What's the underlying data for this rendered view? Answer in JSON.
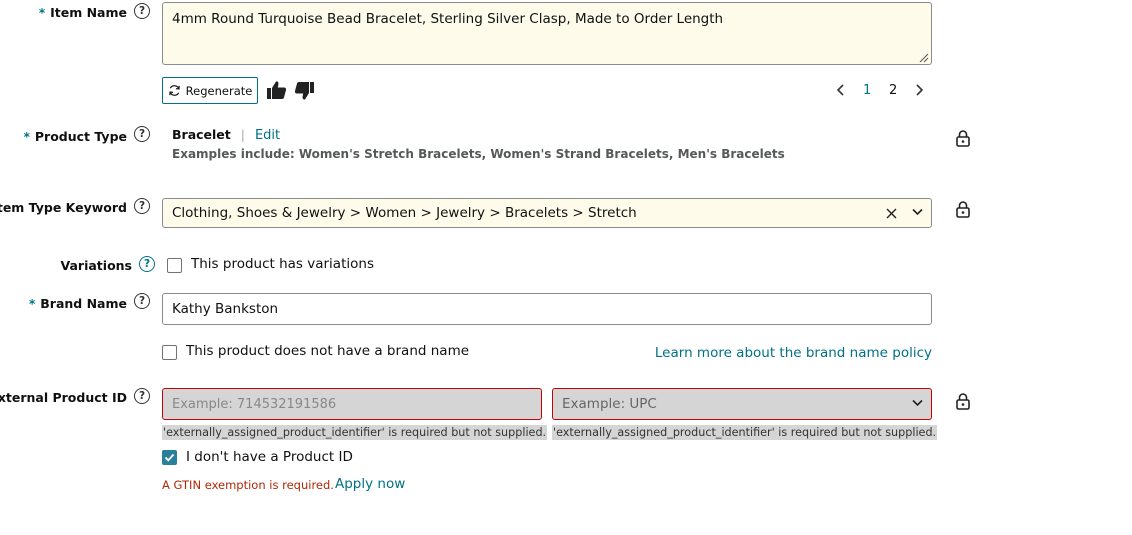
{
  "item_name": {
    "label": "Item Name",
    "required_mark": "*",
    "value": "4mm Round Turquoise Bead Bracelet, Sterling Silver Clasp, Made to Order Length",
    "regenerate_label": "Regenerate",
    "pages": [
      "1",
      "2"
    ]
  },
  "product_type": {
    "label": "Product Type",
    "required_mark": "*",
    "value": "Bracelet",
    "separator": "|",
    "edit_label": "Edit",
    "examples": "Examples include: Women's Stretch Bracelets, Women's Strand Bracelets, Men's Bracelets"
  },
  "item_type_keyword": {
    "label": "Item Type Keyword",
    "value": "Clothing, Shoes & Jewelry > Women > Jewelry > Bracelets > Stretch"
  },
  "variations": {
    "label": "Variations",
    "checkbox_label": "This product has variations"
  },
  "brand_name": {
    "label": "Brand Name",
    "required_mark": "*",
    "value": "Kathy Bankston",
    "no_brand_label": "This product does not have a brand name",
    "policy_link": "Learn more about the brand name policy"
  },
  "external_product_id": {
    "label": "External Product ID",
    "id_placeholder": "Example: 714532191586",
    "type_placeholder": "Example: UPC",
    "error_message": "'externally_assigned_product_identifier' is required but not supplied.",
    "no_id_label": "I don't have a Product ID",
    "gtin_message": "A GTIN exemption is required.",
    "apply_link": "Apply now"
  },
  "colors": {
    "teal": "#007185",
    "yellow_bg": "#fffbeb",
    "error_red": "#c40000",
    "error_text": "#b12704",
    "checkbox_checked": "#2a7f9a"
  }
}
